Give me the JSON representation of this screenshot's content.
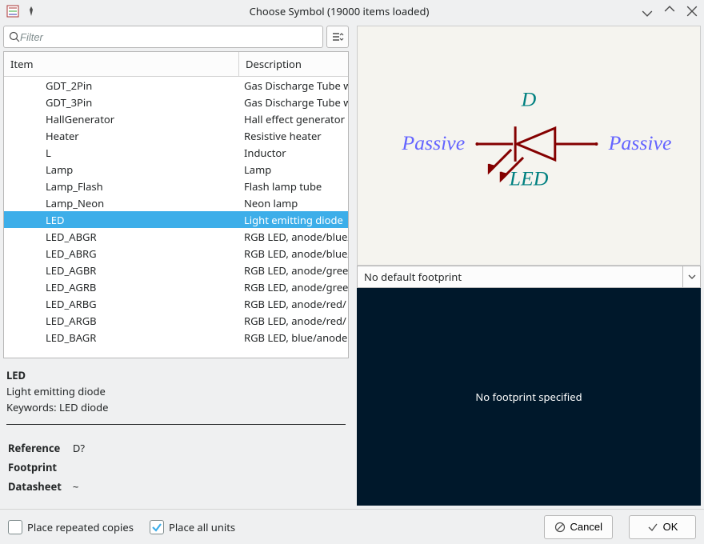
{
  "window": {
    "title": "Choose Symbol (19000 items loaded)"
  },
  "search": {
    "placeholder": "Filter"
  },
  "columns": {
    "item": "Item",
    "description": "Description"
  },
  "rows": [
    {
      "item": "GDT_2Pin",
      "desc": "Gas Discharge Tube w",
      "selected": false
    },
    {
      "item": "GDT_3Pin",
      "desc": "Gas Discharge Tube w",
      "selected": false
    },
    {
      "item": "HallGenerator",
      "desc": "Hall effect generator",
      "selected": false
    },
    {
      "item": "Heater",
      "desc": "Resistive heater",
      "selected": false
    },
    {
      "item": "L",
      "desc": "Inductor",
      "selected": false
    },
    {
      "item": "Lamp",
      "desc": "Lamp",
      "selected": false
    },
    {
      "item": "Lamp_Flash",
      "desc": "Flash lamp tube",
      "selected": false
    },
    {
      "item": "Lamp_Neon",
      "desc": "Neon lamp",
      "selected": false
    },
    {
      "item": "LED",
      "desc": "Light emitting diode",
      "selected": true
    },
    {
      "item": "LED_ABGR",
      "desc": "RGB LED, anode/blue/",
      "selected": false
    },
    {
      "item": "LED_ABRG",
      "desc": "RGB LED, anode/blue/",
      "selected": false
    },
    {
      "item": "LED_AGBR",
      "desc": "RGB LED, anode/gree",
      "selected": false
    },
    {
      "item": "LED_AGRB",
      "desc": "RGB LED, anode/gree",
      "selected": false
    },
    {
      "item": "LED_ARBG",
      "desc": "RGB LED, anode/red/",
      "selected": false
    },
    {
      "item": "LED_ARGB",
      "desc": "RGB LED, anode/red/",
      "selected": false
    },
    {
      "item": "LED_BAGR",
      "desc": "RGB LED, blue/anode",
      "selected": false
    }
  ],
  "details": {
    "name": "LED",
    "description": "Light emitting diode",
    "keywords_label": "Keywords:",
    "keywords_value": "LED diode",
    "reference_label": "Reference",
    "reference_value": "D?",
    "footprint_label": "Footprint",
    "footprint_value": "",
    "datasheet_label": "Datasheet",
    "datasheet_value": "~"
  },
  "preview": {
    "refdes": "D",
    "value": "LED",
    "pin_left": "Passive",
    "pin_right": "Passive"
  },
  "footprint_combo": {
    "text": "No default footprint"
  },
  "footprint_view": {
    "message": "No footprint specified"
  },
  "bottom": {
    "place_repeated": "Place repeated copies",
    "place_all_units": "Place all units",
    "cancel": "Cancel",
    "ok": "OK"
  }
}
